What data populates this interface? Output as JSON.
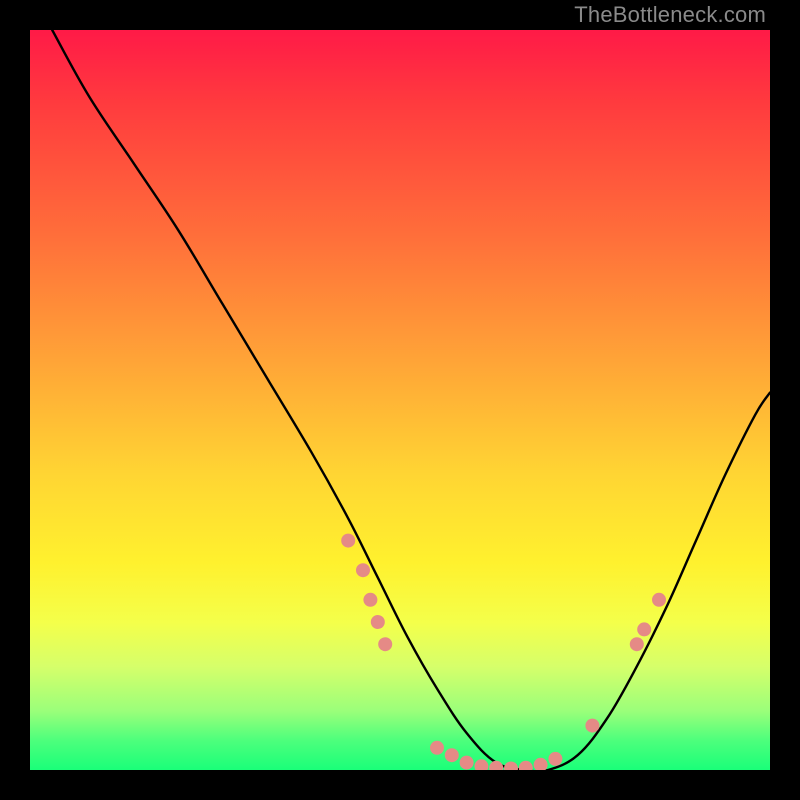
{
  "watermark": "TheBottleneck.com",
  "chart_data": {
    "type": "line",
    "title": "",
    "xlabel": "",
    "ylabel": "",
    "xlim": [
      0,
      100
    ],
    "ylim": [
      0,
      100
    ],
    "grid": false,
    "legend": false,
    "background": "red-yellow-green vertical gradient",
    "series": [
      {
        "name": "curve",
        "color": "#000000",
        "x": [
          3,
          8,
          14,
          20,
          26,
          32,
          38,
          43,
          47,
          51,
          55,
          59,
          63,
          67,
          70,
          74,
          78,
          82,
          86,
          90,
          94,
          98,
          100
        ],
        "y": [
          100,
          91,
          82,
          73,
          63,
          53,
          43,
          34,
          26,
          18,
          11,
          5,
          1,
          0,
          0,
          2,
          7,
          14,
          22,
          31,
          40,
          48,
          51
        ]
      }
    ],
    "markers": {
      "name": "dots",
      "color": "#e58a86",
      "radius": 7,
      "points": [
        {
          "x": 43,
          "y": 31
        },
        {
          "x": 45,
          "y": 27
        },
        {
          "x": 46,
          "y": 23
        },
        {
          "x": 47,
          "y": 20
        },
        {
          "x": 48,
          "y": 17
        },
        {
          "x": 55,
          "y": 3
        },
        {
          "x": 57,
          "y": 2
        },
        {
          "x": 59,
          "y": 1
        },
        {
          "x": 61,
          "y": 0.5
        },
        {
          "x": 63,
          "y": 0.3
        },
        {
          "x": 65,
          "y": 0.2
        },
        {
          "x": 67,
          "y": 0.3
        },
        {
          "x": 69,
          "y": 0.7
        },
        {
          "x": 71,
          "y": 1.5
        },
        {
          "x": 76,
          "y": 6
        },
        {
          "x": 82,
          "y": 17
        },
        {
          "x": 83,
          "y": 19
        },
        {
          "x": 85,
          "y": 23
        }
      ]
    }
  }
}
